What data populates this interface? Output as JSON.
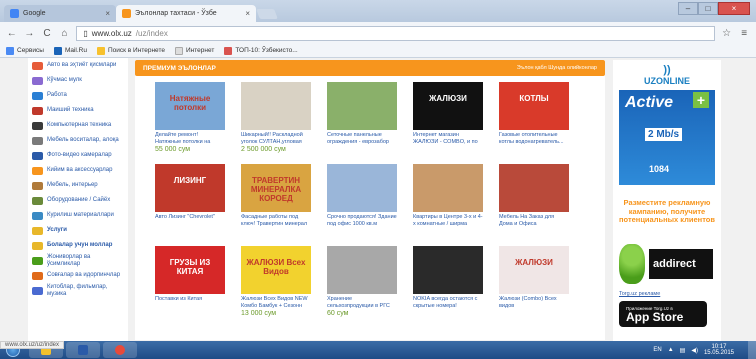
{
  "browser": {
    "tabs": [
      {
        "label": "Google",
        "fav_color": "#4285f4"
      },
      {
        "label": "Эълонлар тахтаси - Ўзбе",
        "fav_color": "#f7951d"
      }
    ],
    "url_domain": "www.olx.uz",
    "url_path": "/uz/index",
    "bookmarks": [
      {
        "label": "Сервисы",
        "color": "#4a8af4"
      },
      {
        "label": "Mail.Ru",
        "color": "#1a64b8"
      },
      {
        "label": "Поиск в Интернете",
        "color": "#f7c12e"
      },
      {
        "label": "Интернет",
        "color": "#dddddd"
      },
      {
        "label": "ТОП-10: Ўзбекисто...",
        "color": "#d9534f"
      }
    ]
  },
  "sidebar": {
    "items": [
      {
        "label": "Авто ва эҳтиёт қисмлари",
        "color": "#e65c3a"
      },
      {
        "label": "Кўчмас мулк",
        "color": "#8a6ad1"
      },
      {
        "label": "Работа",
        "color": "#2a7fd4"
      },
      {
        "label": "Маиший техника",
        "color": "#c0392b"
      },
      {
        "label": "Компьютерная техника",
        "color": "#3a3a3a"
      },
      {
        "label": "Мебель воситалар, алоқа",
        "color": "#7a7a7a"
      },
      {
        "label": "Фото-видео камералар",
        "color": "#2a5aa8"
      },
      {
        "label": "Кийим ва аксессуарлар",
        "color": "#f7951d"
      },
      {
        "label": "Мебель, интерьер",
        "color": "#b07a3a"
      },
      {
        "label": "Оборудование / Сайёх",
        "color": "#6a8a3a"
      },
      {
        "label": "Курилиш материаллари",
        "color": "#3a8ac4"
      },
      {
        "label": "Услуги",
        "color": "#e8b72a"
      },
      {
        "label": "Болалар учун моллар",
        "color": "#e8b72a"
      },
      {
        "label": "Жониворлар ва ўсимликлар",
        "color": "#4a9d1a"
      },
      {
        "label": "Совғалар ва идорпинчлар",
        "color": "#e06a1a"
      },
      {
        "label": "Китоблар, фильмлар, музика",
        "color": "#4a6ad1"
      }
    ]
  },
  "main": {
    "title": "ПРЕМИУМ ЭЪЛОНЛАР",
    "link": "Эълон қабл Шунда олийконлар",
    "cards": [
      {
        "title": "Делайте ремонт! Натяжные потолки на первых рус!",
        "price": "55 000 сум",
        "thumb_text": "Натяжные потолки",
        "bg": "#7aa7d6"
      },
      {
        "title": "Шикарный!! Раскладной уголок СУЛТАН,угловая",
        "price": "2 500 000 сум",
        "thumb_text": "",
        "bg": "#d9d2c4"
      },
      {
        "title": "Сеточные панельные ограждения - еврозабор",
        "price": "",
        "thumb_text": "",
        "bg": "#8ab06a"
      },
      {
        "title": "Интернет магазин ЖАЛЮЗИ - COMBO, и по терминалу",
        "price": "",
        "thumb_text": "ЖАЛЮЗИ",
        "bg": "#111111"
      },
      {
        "title": "Газовые отопительные котлы водонагреватель...",
        "price": "",
        "thumb_text": "КОТЛЫ",
        "bg": "#d93a2a"
      },
      {
        "title": "Авто Лизинг \"Chevrolet\"",
        "price": "",
        "thumb_text": "ЛИЗИНГ",
        "bg": "#c0392b"
      },
      {
        "title": "Фасадные работы под ключ! Травертин минерал",
        "price": "",
        "thumb_text": "ТРАВЕРТИН МИНЕРАЛКА КОРОЕД",
        "bg": "#d9a441"
      },
      {
        "title": "Срочно продаются! Здание под офис 1000 кв.м",
        "price": "",
        "thumb_text": "",
        "bg": "#9ab6d9"
      },
      {
        "title": "Квартиры в Центре 3-х и 4-х комнатные / ширма",
        "price": "",
        "thumb_text": "",
        "bg": "#c99a6a"
      },
      {
        "title": "Мебель На Заказ для Дома и Офиса",
        "price": "",
        "thumb_text": "",
        "bg": "#b94a3a"
      },
      {
        "title": "Поставки из Китая",
        "price": "",
        "thumb_text": "ГРУЗЫ ИЗ КИТАЯ",
        "bg": "#d62828"
      },
      {
        "title": "Жалюзи Всех Видов NEW Комбо Бамбук + Сезонн",
        "price": "13 000 сум",
        "thumb_text": "ЖАЛЮЗИ Всех Видов",
        "bg": "#f2d22e"
      },
      {
        "title": "Хранение сельхозпродукции в РГС",
        "price": "60 сум",
        "thumb_text": "",
        "bg": "#a8a8a8"
      },
      {
        "title": "NOKIA всегда остаются с скрытые номера!",
        "price": "",
        "thumb_text": "",
        "bg": "#2a2a2a"
      },
      {
        "title": "Жалюзи (Combo) Всех видов",
        "price": "",
        "thumb_text": "ЖАЛЮЗИ",
        "bg": "#f0e6e6"
      }
    ]
  },
  "right": {
    "brand": "UZONLINE",
    "active_label": "Active",
    "speed_label": "2 Mb/s",
    "number_label": "1084",
    "ad_text": "Разместите рекламную кампанию, получите потенциальных клиентов",
    "addirect_label": "addirect",
    "torg_link": "Torg.uz рекламе",
    "appstore_small": "Приложение Torg.Uz в",
    "appstore_big": "App Store"
  },
  "status": {
    "url": "www.olx.uz/uz/index"
  },
  "taskbar": {
    "lang": "EN",
    "time": "10:17",
    "date": "15.05.2015",
    "items": [
      {
        "name": "explorer",
        "color": "#f2c12e"
      },
      {
        "name": "word",
        "color": "#2a5aa8"
      },
      {
        "name": "chrome",
        "color": "#e84a3a"
      }
    ]
  }
}
